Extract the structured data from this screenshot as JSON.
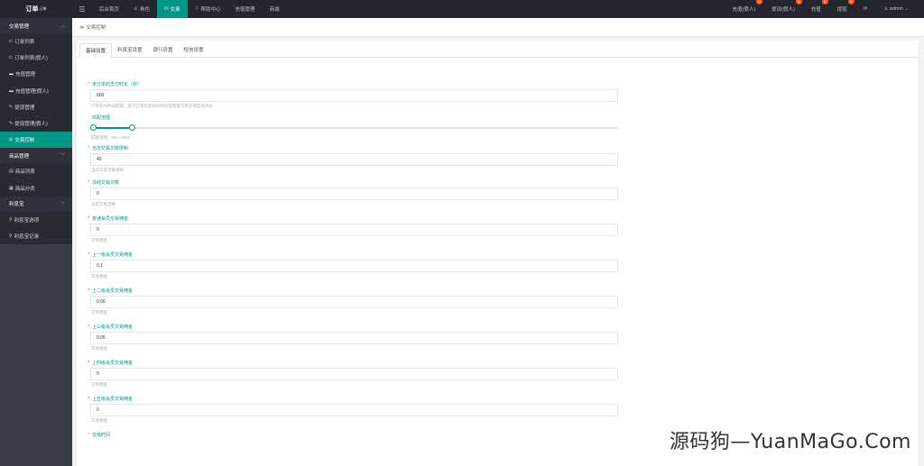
{
  "app": {
    "logo": "订单",
    "logo_sup": "订单"
  },
  "topnav": [
    {
      "icon": "",
      "label": "后台首页"
    },
    {
      "icon": "♙",
      "label": "角色"
    },
    {
      "icon": "⛁",
      "label": "交易",
      "active": true
    },
    {
      "icon": "⚐",
      "label": "帮助中心"
    },
    {
      "icon": "",
      "label": "充值管理"
    },
    {
      "icon": "",
      "label": "商城"
    }
  ],
  "topright": [
    {
      "label": "充值(假人)",
      "badge": "0"
    },
    {
      "label": "提现(假人)",
      "badge": "0"
    },
    {
      "label": "充值",
      "badge": "0"
    },
    {
      "label": "提现",
      "badge": "0"
    },
    {
      "label": "⟳",
      "badge": ""
    },
    {
      "label": "♙ admin ⌄",
      "badge": ""
    }
  ],
  "sidebar": {
    "groups": [
      {
        "label": "交易管理",
        "items": [
          {
            "icon": "⊏",
            "label": "订单列表"
          },
          {
            "icon": "⊏",
            "label": "订单列表(假人)"
          },
          {
            "icon": "▬",
            "label": "充值管理"
          },
          {
            "icon": "▬",
            "label": "充值管理(假人)"
          },
          {
            "icon": "✎",
            "label": "提现管理"
          },
          {
            "icon": "✎",
            "label": "提现管理(假人)"
          },
          {
            "icon": "◎",
            "label": "交易控制",
            "active": true
          }
        ]
      },
      {
        "label": "商品管理",
        "items": [
          {
            "icon": "▤",
            "label": "商品列表"
          },
          {
            "icon": "▦",
            "label": "商品分类"
          }
        ]
      },
      {
        "label": "利息宝",
        "items": [
          {
            "icon": "⚲",
            "label": "利息宝选项"
          },
          {
            "icon": "⚲",
            "label": "利息宝记录"
          }
        ]
      }
    ]
  },
  "breadcrumb": "≫ 交易控制",
  "tabs": [
    "基础设置",
    "利息宝设置",
    "银行设置",
    "短信设置"
  ],
  "form": {
    "order_timeout": {
      "label": "未订单的支付时长（秒）",
      "value": "600",
      "help": "订单支付时间结束，则下订单在此处的时间后结束订单交易自动流标"
    },
    "range": {
      "label": "匹配范围",
      "help": "匹配范围：5% ~ 85%",
      "low": 0,
      "high": 0.08
    },
    "daily_limit": {
      "label": "当日交易次数限制",
      "value": "40",
      "help": "当日交易次数限制"
    },
    "freeze_times": {
      "label": "冻结交易次数",
      "value": "0",
      "help": "冻结交易次数"
    },
    "normal_commission": {
      "label": "普通会员交易佣金",
      "value": "0",
      "help": "交易佣金"
    },
    "level1_commission": {
      "label": "上一级会员交易佣金",
      "value": "0.1",
      "help": "交易佣金"
    },
    "level2_commission": {
      "label": "上二级会员交易佣金",
      "value": "0.06",
      "help": "交易佣金"
    },
    "level3_commission": {
      "label": "上三级会员交易佣金",
      "value": "0.05",
      "help": "交易佣金"
    },
    "level4_commission": {
      "label": "上四级会员交易佣金",
      "value": "0",
      "help": "交易佣金"
    },
    "level5_commission": {
      "label": "上五级会员交易佣金",
      "value": "0",
      "help": "交易佣金"
    },
    "trade_time": {
      "label": "交易时间"
    }
  },
  "watermark": "源码狗—YuanMaGo.Com"
}
